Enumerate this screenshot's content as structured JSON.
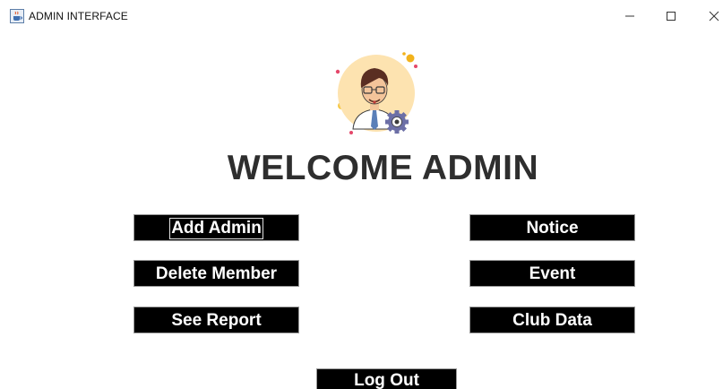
{
  "window": {
    "title": "ADMIN INTERFACE",
    "icon": "java-cup-icon",
    "controls": [
      "minimize-icon",
      "maximize-icon",
      "close-icon"
    ]
  },
  "avatar": {
    "icon": "admin-avatar-with-gear-icon"
  },
  "heading": "WELCOME ADMIN",
  "buttons": {
    "add_admin": "Add Admin",
    "delete_member": "Delete Member",
    "see_report": "See Report",
    "notice": "Notice",
    "event": "Event",
    "club_data": "Club Data",
    "log_out": "Log Out"
  },
  "colors": {
    "button_bg": "#000000",
    "button_text": "#ffffff",
    "heading": "#2e2e2e",
    "avatar_bg": "#fde3b0",
    "gear": "#6c6fa6"
  }
}
